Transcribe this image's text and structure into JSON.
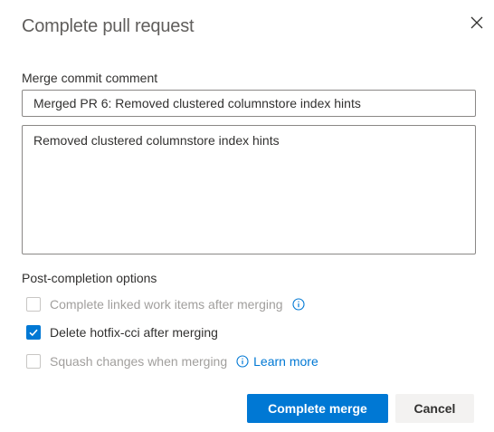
{
  "dialog": {
    "title": "Complete pull request"
  },
  "merge_comment": {
    "label": "Merge commit comment",
    "title_value": "Merged PR 6: Removed clustered columnstore index hints",
    "body_value": "Removed clustered columnstore index hints"
  },
  "post_completion": {
    "label": "Post-completion options",
    "options": [
      {
        "label": "Complete linked work items after merging",
        "checked": false,
        "disabled": true
      },
      {
        "label": "Delete hotfix-cci after merging",
        "checked": true,
        "disabled": false
      },
      {
        "label": "Squash changes when merging",
        "checked": false,
        "disabled": true
      }
    ],
    "learn_more": "Learn more"
  },
  "buttons": {
    "complete": "Complete merge",
    "cancel": "Cancel"
  },
  "colors": {
    "accent": "#0078d4",
    "text": "#323130",
    "muted": "#a19f9d"
  },
  "icons": {
    "close": "close-icon",
    "info": "info-icon",
    "check": "check-icon"
  }
}
